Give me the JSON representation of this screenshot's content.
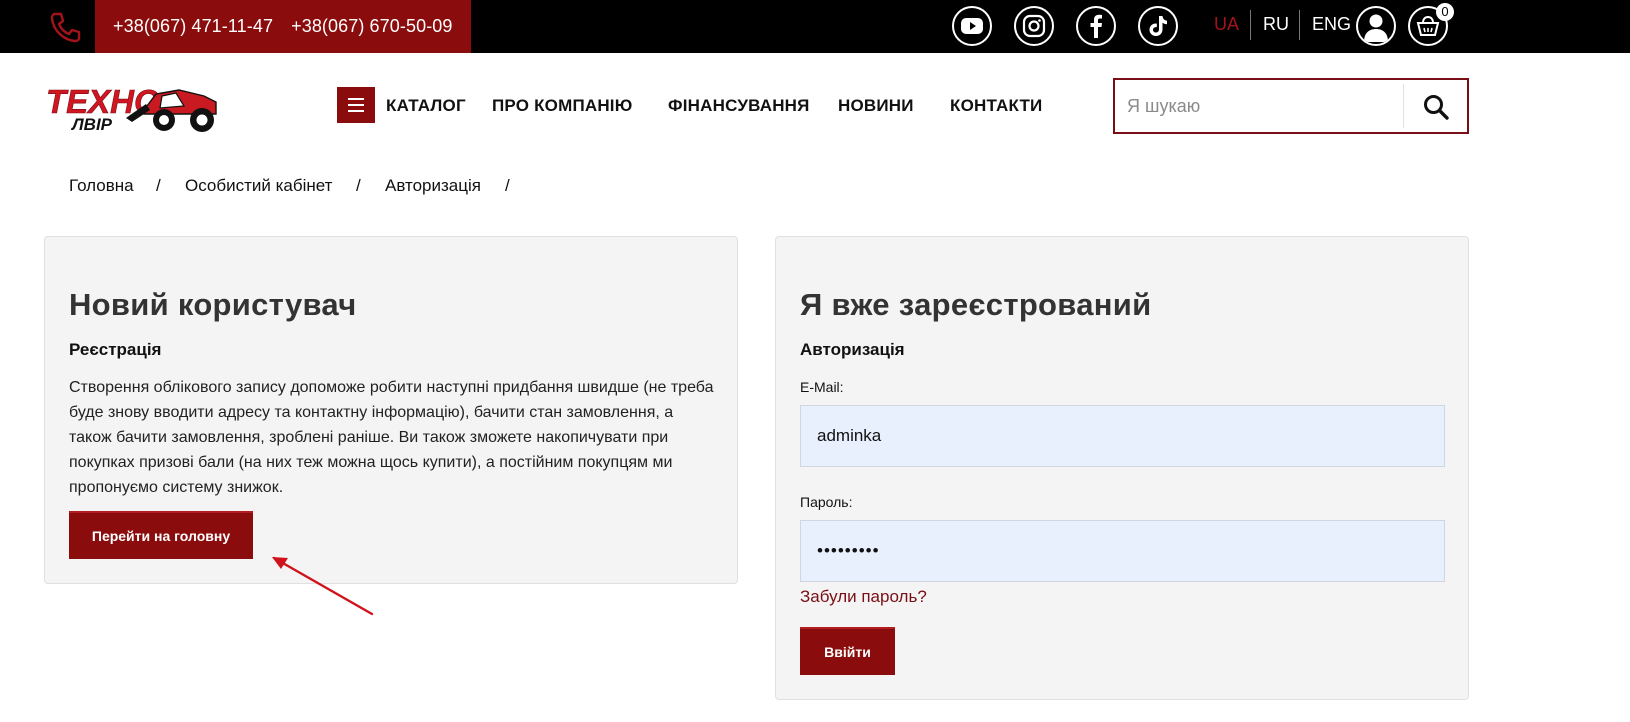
{
  "topbar": {
    "phones": [
      "+38(067) 471-11-47",
      "+38(067) 670-50-09"
    ],
    "socials": [
      "youtube-icon",
      "instagram-icon",
      "facebook-icon",
      "tiktok-icon"
    ],
    "languages": [
      {
        "label": "UA",
        "active": true
      },
      {
        "label": "RU",
        "active": false
      },
      {
        "label": "ENG",
        "active": false
      }
    ],
    "cart_count": "0"
  },
  "header": {
    "logo_text": "ТЕХНО ЛВІР",
    "nav": [
      "КАТАЛОГ",
      "ПРО КОМПАНІЮ",
      "ФІНАНСУВАННЯ",
      "НОВИНИ",
      "КОНТАКТИ"
    ],
    "search_placeholder": "Я шукаю"
  },
  "breadcrumb": [
    "Головна",
    "/",
    "Особистий кабінет",
    "/",
    "Авторизація",
    "/"
  ],
  "new_user": {
    "title": "Новий користувач",
    "subtitle": "Реєстрація",
    "description": "Створення облікового запису допоможе робити наступні придбання швидше (не треба буде знову вводити адресу та контактну інформацію), бачити стан замовлення, а також бачити замовлення, зроблені раніше. Ви також зможете накопичувати при покупках призові бали (на них теж можна щось купити), а постійним покупцям ми пропонуємо систему знижок.",
    "button": "Перейти на головну"
  },
  "login": {
    "title": "Я вже зареєстрований",
    "subtitle": "Авторизація",
    "email_label": "E-Mail:",
    "email_value": "adminka",
    "password_label": "Пароль:",
    "password_value": "•••••••••",
    "forgot": "Забули пароль?",
    "button": "Ввійти"
  },
  "colors": {
    "brand": "#8b0c0c",
    "active_lang": "#a3141a",
    "annotation_arrow": "#d0121a"
  }
}
